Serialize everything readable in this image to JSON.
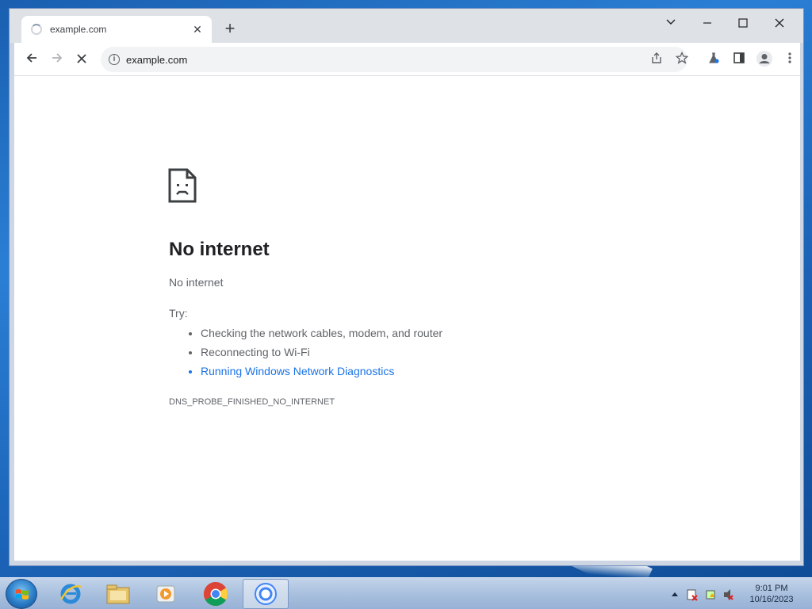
{
  "browser": {
    "tab_title": "example.com",
    "tab_close": "✕",
    "new_tab": "+",
    "url": "example.com"
  },
  "error": {
    "title": "No internet",
    "subtitle": "No internet",
    "try_label": "Try:",
    "suggestions": [
      "Checking the network cables, modem, and router",
      "Reconnecting to Wi-Fi",
      "Running Windows Network Diagnostics"
    ],
    "code": "DNS_PROBE_FINISHED_NO_INTERNET"
  },
  "taskbar": {
    "time": "9:01 PM",
    "date": "10/16/2023"
  },
  "colors": {
    "link": "#1a73e8",
    "text_secondary": "#5f6368",
    "text_primary": "#202124"
  }
}
